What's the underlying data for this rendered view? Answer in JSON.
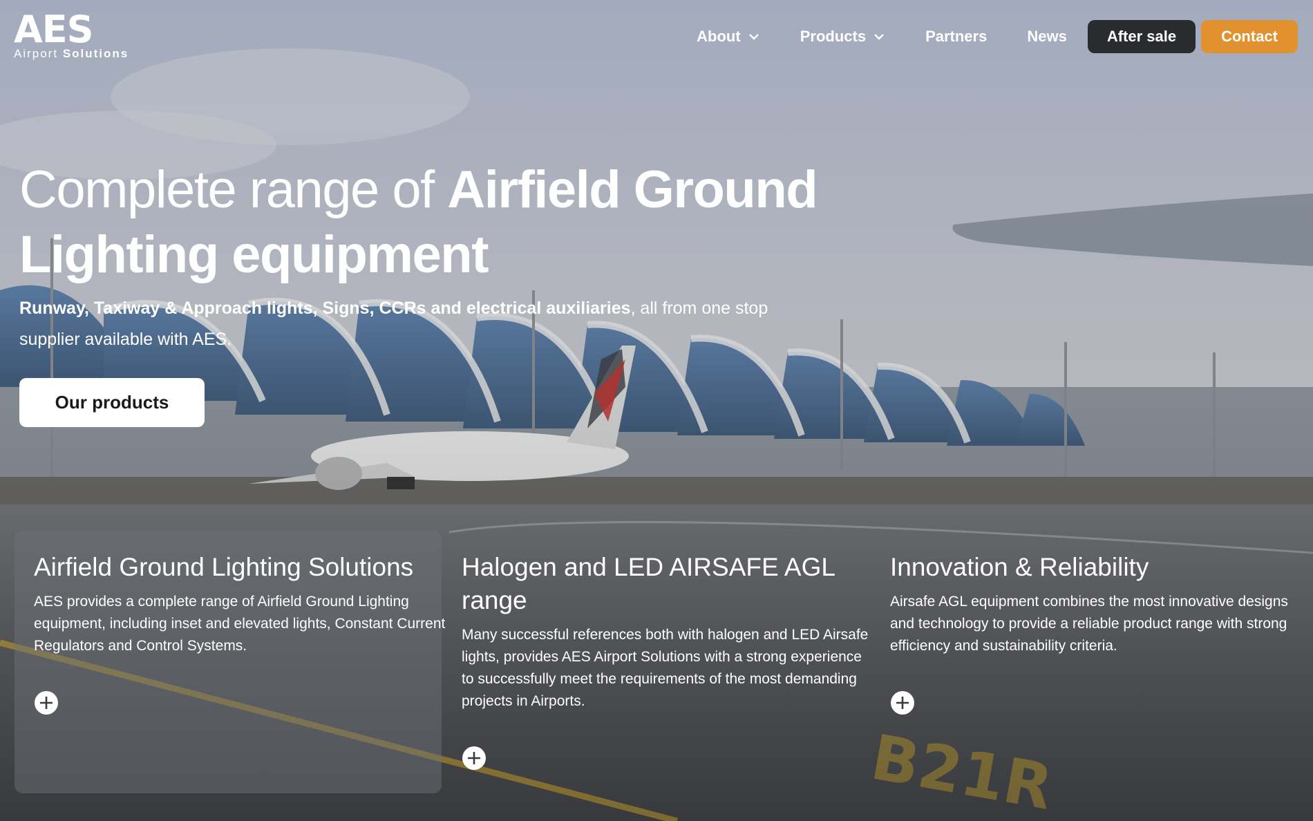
{
  "brand": {
    "mark": "AES",
    "sub_light": "Airport",
    "sub_bold": "Solutions"
  },
  "nav": {
    "items": [
      {
        "label": "About",
        "has_dropdown": true
      },
      {
        "label": "Products",
        "has_dropdown": true
      },
      {
        "label": "Partners",
        "has_dropdown": false
      },
      {
        "label": "News",
        "has_dropdown": false
      }
    ],
    "after_sale": "After sale",
    "contact": "Contact"
  },
  "hero": {
    "headline_light": "Complete range of ",
    "headline_bold": "Airfield Ground Lighting equipment",
    "sub_bold": "Runway, Taxiway & Approach lights, Signs, CCRs and electrical auxiliaries",
    "sub_rest": ", all from one stop supplier available with AES.",
    "cta": "Our products"
  },
  "cards": [
    {
      "title": "Airfield Ground Lighting Solutions",
      "text": "AES provides a complete range of Airfield Ground Lighting equipment, including inset and elevated lights, Constant Current Regulators and Control Systems."
    },
    {
      "title": "Halogen and LED AIRSAFE AGL range",
      "text": "Many successful references both with halogen and LED Airsafe lights, provides AES Airport Solutions with a strong experience to successfully meet the requirements of the most demanding projects in Airports."
    },
    {
      "title": "Innovation & Reliability",
      "text": "Airsafe AGL equipment combines the most innovative designs and technology to provide a reliable product range with strong efficiency and sustainability criteria."
    }
  ],
  "colors": {
    "accent": "#e1912e",
    "dark_button": "#2a2b2e"
  },
  "icons": {
    "dropdown": "chevron-down-icon",
    "expand": "plus-circle-icon"
  }
}
